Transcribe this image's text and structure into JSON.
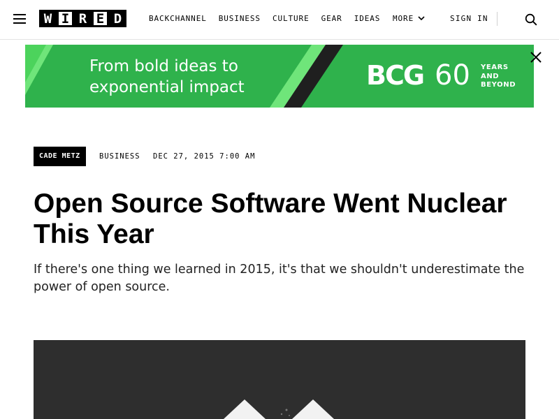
{
  "header": {
    "logo_letters": [
      "W",
      "I",
      "R",
      "E",
      "D"
    ],
    "nav": [
      {
        "label": "BACKCHANNEL"
      },
      {
        "label": "BUSINESS"
      },
      {
        "label": "CULTURE"
      },
      {
        "label": "GEAR"
      },
      {
        "label": "IDEAS"
      }
    ],
    "more_label": "MORE",
    "sign_in_label": "SIGN IN"
  },
  "ad": {
    "headline_line1": "From bold ideas to",
    "headline_line2": "exponential impact",
    "brand": "BCG",
    "number": "60",
    "years_line1": "YEARS",
    "years_line2": "AND",
    "years_line3": "BEYOND",
    "colors": {
      "green": "#2fb24c",
      "dark": "#1f1f1f",
      "bright_green": "#5fe06a"
    }
  },
  "article": {
    "author": "CADE METZ",
    "section": "BUSINESS",
    "date": "DEC 27, 2015 7:00 AM",
    "title": "Open Source Software Went Nuclear This Year",
    "dek": "If there's one thing we learned in 2015, it's that we shouldn't underestimate the power of open source."
  },
  "icons": {
    "menu": "hamburger-menu-icon",
    "search": "search-icon",
    "close": "close-icon",
    "chevron": "chevron-down-icon"
  }
}
